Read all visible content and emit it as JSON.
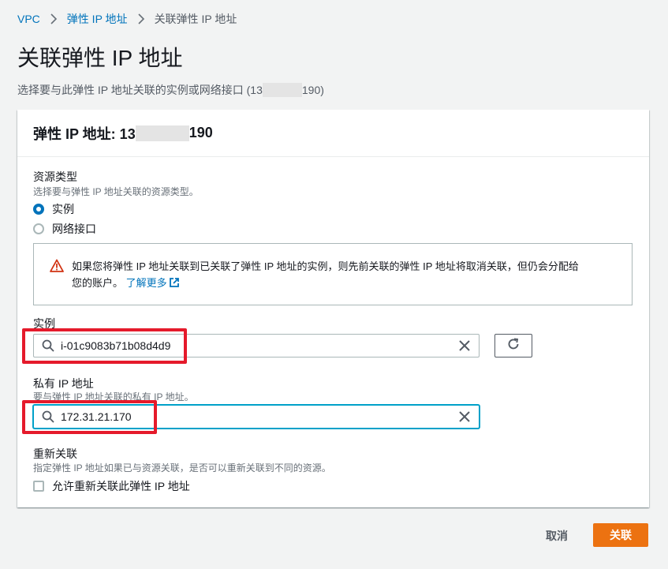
{
  "breadcrumb": {
    "items": [
      "VPC",
      "弹性 IP 地址",
      "关联弹性 IP 地址"
    ]
  },
  "page": {
    "title": "关联弹性 IP 地址",
    "description_prefix": "选择要与此弹性 IP 地址关联的实例或网络接口 (13",
    "description_suffix": "190)"
  },
  "panel": {
    "header_prefix": "弹性 IP 地址: 13",
    "header_suffix": "190"
  },
  "resource_type": {
    "label": "资源类型",
    "description": "选择要与弹性 IP 地址关联的资源类型。",
    "options": [
      "实例",
      "网络接口"
    ],
    "selected": "实例"
  },
  "alert": {
    "line1": "如果您将弹性 IP 地址关联到已关联了弹性 IP 地址的实例，则先前关联的弹性 IP 地址将取消关联，但仍会分配给",
    "line2": "您的账户。",
    "link": "了解更多"
  },
  "instance": {
    "label": "实例",
    "value": "i-01c9083b71b08d4d9"
  },
  "private_ip": {
    "label": "私有 IP 地址",
    "description": "要与弹性 IP 地址关联的私有 IP 地址。",
    "value": "172.31.21.170"
  },
  "reassociation": {
    "label": "重新关联",
    "description": "指定弹性 IP 地址如果已与资源关联，是否可以重新关联到不同的资源。",
    "checkbox_label": "允许重新关联此弹性 IP 地址",
    "checked": false
  },
  "actions": {
    "cancel": "取消",
    "associate": "关联"
  },
  "colors": {
    "link": "#0073bb",
    "primary": "#ec7211",
    "highlight": "#e51a2b",
    "warning": "#d13212",
    "focus": "#00a1c9"
  },
  "icons": [
    "chevron-right-icon",
    "warning-icon",
    "external-link-icon",
    "search-icon",
    "clear-icon",
    "refresh-icon"
  ]
}
